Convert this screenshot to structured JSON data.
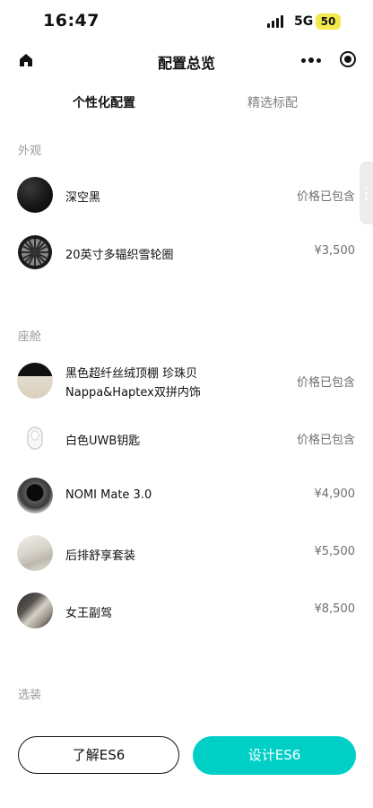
{
  "status_bar": {
    "time": "16:47",
    "network": "5G",
    "battery": "50"
  },
  "header": {
    "title": "配置总览"
  },
  "tabs": [
    {
      "label": "个性化配置",
      "active": true
    },
    {
      "label": "精选标配",
      "active": false
    }
  ],
  "sections": {
    "exterior": {
      "label": "外观",
      "items": [
        {
          "name": "深空黑",
          "price": "价格已包含"
        },
        {
          "name": "20英寸多辐织雪轮圈",
          "price": "¥3,500"
        }
      ]
    },
    "cabin": {
      "label": "座舱",
      "items": [
        {
          "name_line1": "黑色超纤丝绒顶棚 珍珠贝",
          "name_line2": "Nappa&Haptex双拼内饰",
          "price": "价格已包含"
        },
        {
          "name": "白色UWB钥匙",
          "price": "价格已包含"
        },
        {
          "name": "NOMI Mate 3.0",
          "price": "¥4,900"
        },
        {
          "name": "后排舒享套装",
          "price": "¥5,500"
        },
        {
          "name": "女王副驾",
          "price": "¥8,500"
        }
      ]
    },
    "options": {
      "label": "选装"
    }
  },
  "actions": {
    "learn_label": "了解ES6",
    "design_label": "设计ES6"
  },
  "colors": {
    "accent": "#00cfc6",
    "text": "#111111",
    "muted": "#9a9a9a"
  }
}
